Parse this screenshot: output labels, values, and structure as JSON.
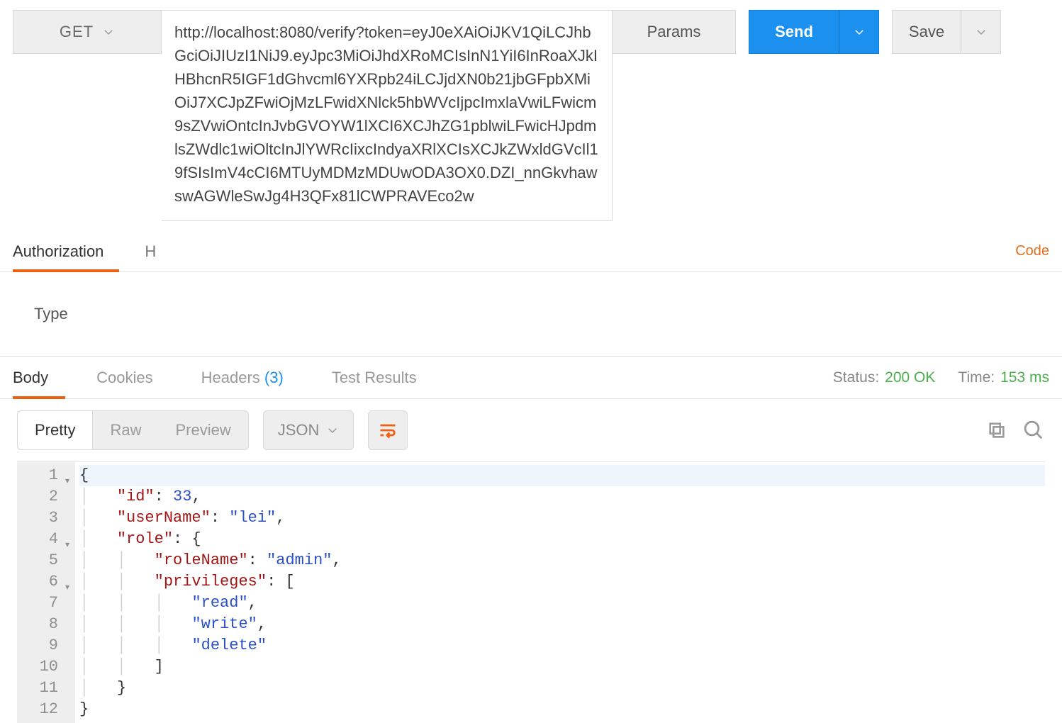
{
  "request": {
    "method": "GET",
    "url": "http://localhost:8080/verify?token=eyJ0eXAiOiJKV1QiLCJhbGciOiJIUzI1NiJ9.eyJpc3MiOiJhdXRoMCIsInN1YiI6InRoaXJkIHBhcnR5IGF1dGhvcml6YXRpb24iLCJjdXN0b21jbGFpbXMiOiJ7XCJpZFwiOjMzLFwidXNlck5hbWVcIjpcImxlaVwiLFwicm9sZVwiOntcInJvbGVOYW1lXCI6XCJhZG1pblwiLFwicHJpdmlsZWdlc1wiOltcInJlYWRcIixcIndyaXRlXCIsXCJkZWxldGVcIl19fSIsImV4cCI6MTUyMDMzMDUwODA3OX0.DZI_nnGkvhawswAGWleSwJg4H3QFx81lCWPRAVEco2w",
    "params_label": "Params",
    "send_label": "Send",
    "save_label": "Save"
  },
  "request_tabs": {
    "authorization": "Authorization",
    "headers_partial": "H",
    "code_link": "Code"
  },
  "auth_row": {
    "type_label": "Type"
  },
  "response_tabs": {
    "body": "Body",
    "cookies": "Cookies",
    "headers": "Headers",
    "headers_count": "(3)",
    "test_results": "Test Results"
  },
  "status": {
    "label": "Status:",
    "value": "200 OK"
  },
  "time": {
    "label": "Time:",
    "value": "153 ms"
  },
  "viewer": {
    "pretty": "Pretty",
    "raw": "Raw",
    "preview": "Preview",
    "lang": "JSON"
  },
  "code_lines": {
    "l1": "{",
    "l2_key": "\"id\"",
    "l2_val": "33",
    "l3_key": "\"userName\"",
    "l3_val": "\"lei\"",
    "l4_key": "\"role\"",
    "l5_key": "\"roleName\"",
    "l5_val": "\"admin\"",
    "l6_key": "\"privileges\"",
    "l7": "\"read\"",
    "l8": "\"write\"",
    "l9": "\"delete\"",
    "n1": "1",
    "n2": "2",
    "n3": "3",
    "n4": "4",
    "n5": "5",
    "n6": "6",
    "n7": "7",
    "n8": "8",
    "n9": "9",
    "n10": "10",
    "n11": "11",
    "n12": "12"
  }
}
